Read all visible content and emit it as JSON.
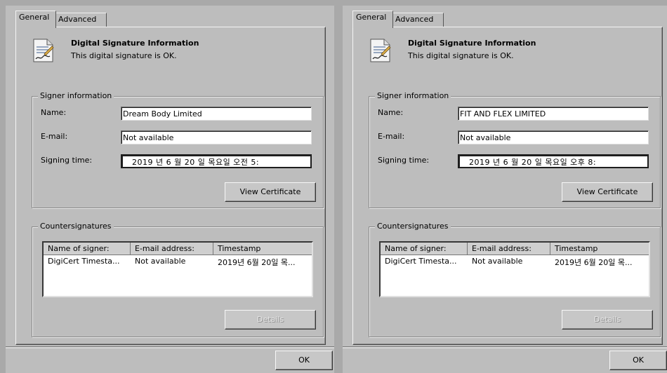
{
  "dialogs": [
    {
      "tabs": [
        {
          "label": "General"
        },
        {
          "label": "Advanced"
        }
      ],
      "header": {
        "title": "Digital Signature Information",
        "status": "This digital signature is OK."
      },
      "signer": {
        "group_label": "Signer information",
        "name_label": "Name:",
        "name_value": "Dream Body Limited",
        "email_label": "E-mail:",
        "email_value": "Not available",
        "time_label": "Signing time:",
        "time_value": "2019 년 6 월 20 일 목요일 오전 5:",
        "view_cert_label": "View Certificate"
      },
      "counter": {
        "group_label": "Countersignatures",
        "columns": [
          "Name of signer:",
          "E-mail address:",
          "Timestamp"
        ],
        "rows": [
          [
            "DigiCert Timesta...",
            "Not available",
            "2019년 6월 20일 목..."
          ]
        ],
        "details_label": "Details"
      },
      "ok_label": "OK"
    },
    {
      "tabs": [
        {
          "label": "General"
        },
        {
          "label": "Advanced"
        }
      ],
      "header": {
        "title": "Digital Signature Information",
        "status": "This digital signature is OK."
      },
      "signer": {
        "group_label": "Signer information",
        "name_label": "Name:",
        "name_value": "FIT AND FLEX LIMITED",
        "email_label": "E-mail:",
        "email_value": "Not available",
        "time_label": "Signing time:",
        "time_value": "2019 년 6 월 20 일 목요일 오후 8:",
        "view_cert_label": "View Certificate"
      },
      "counter": {
        "group_label": "Countersignatures",
        "columns": [
          "Name of signer:",
          "E-mail address:",
          "Timestamp"
        ],
        "rows": [
          [
            "DigiCert Timesta...",
            "Not available",
            "2019년 6월 20일 목..."
          ]
        ],
        "details_label": "Details"
      },
      "ok_label": "OK"
    }
  ],
  "icons": {
    "signature": "signature-document-icon"
  }
}
